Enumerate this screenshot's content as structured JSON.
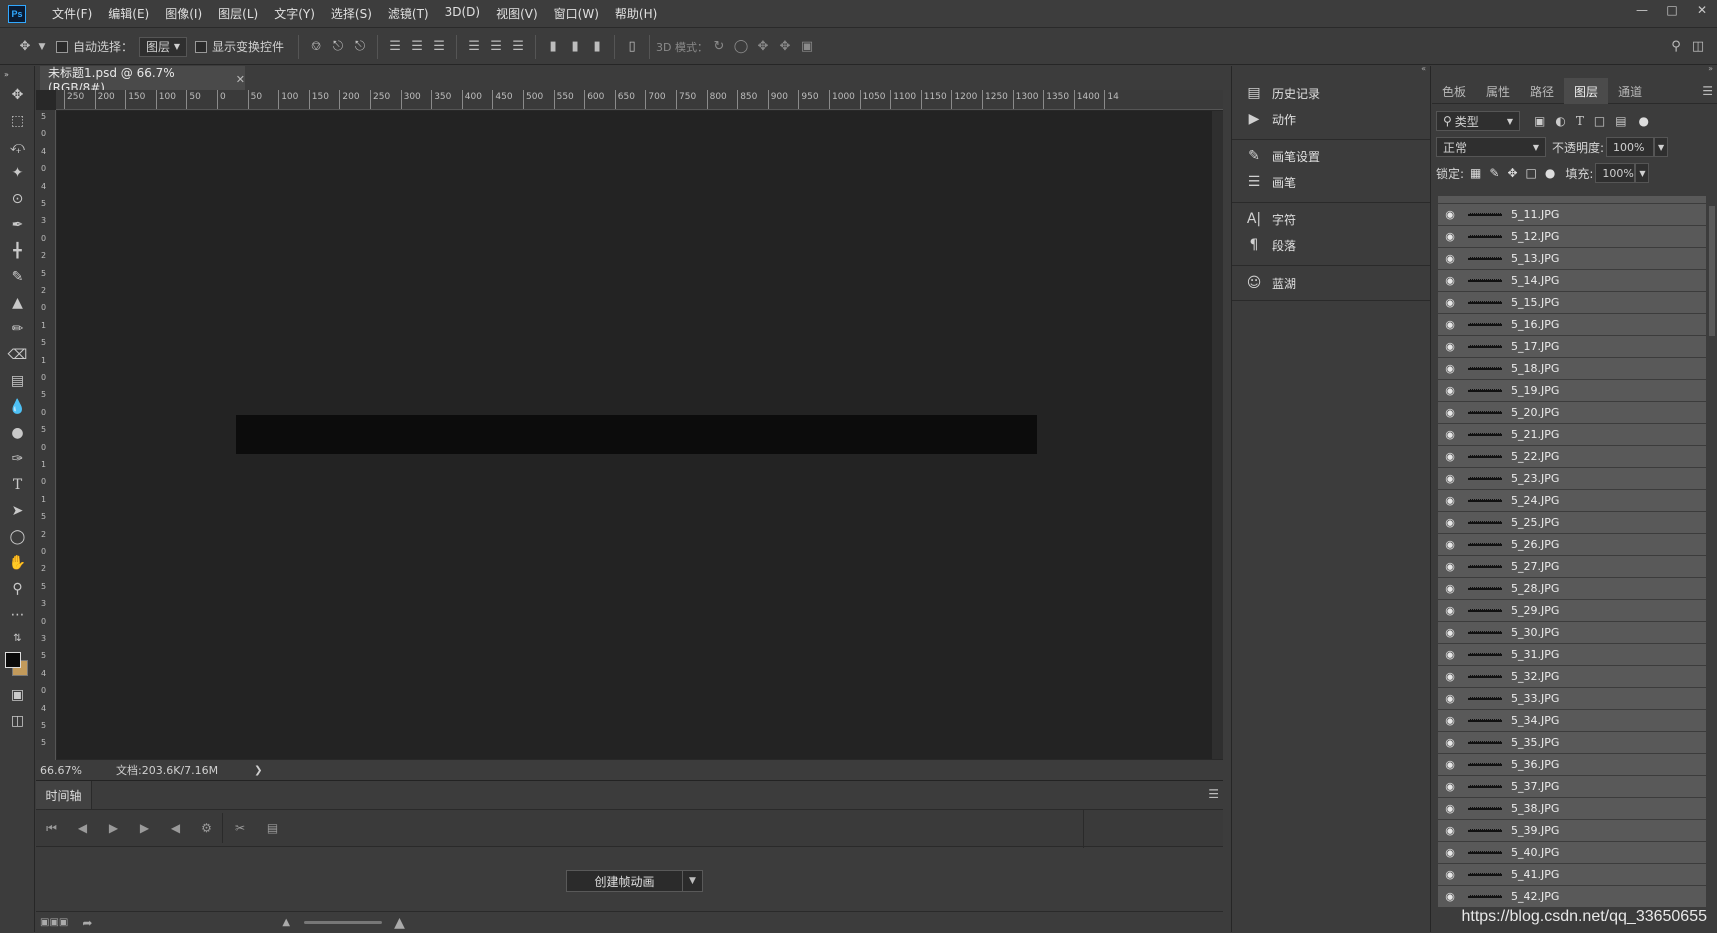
{
  "app": {
    "logo": "Ps",
    "menu": [
      "文件(F)",
      "编辑(E)",
      "图像(I)",
      "图层(L)",
      "文字(Y)",
      "选择(S)",
      "滤镜(T)",
      "3D(D)",
      "视图(V)",
      "窗口(W)",
      "帮助(H)"
    ]
  },
  "options_bar": {
    "auto_select_label": "自动选择：",
    "auto_select_value": "图层",
    "show_transform_label": "显示变换控件",
    "mode_3d_label": "3D 模式："
  },
  "document": {
    "tab_title": "未标题1.psd @ 66.7%(RGB/8#)",
    "zoom": "66.67%",
    "doc_size": "文档:203.6K/7.16M"
  },
  "ruler_h_labels": [
    "250",
    "200",
    "150",
    "100",
    "50",
    "0",
    "50",
    "100",
    "150",
    "200",
    "250",
    "300",
    "350",
    "400",
    "450",
    "500",
    "550",
    "600",
    "650",
    "700",
    "750",
    "800",
    "850",
    "900",
    "950",
    "1000",
    "1050",
    "1100",
    "1150",
    "1200",
    "1250",
    "1300",
    "1350",
    "1400",
    "14"
  ],
  "ruler_v_labels": [
    "5",
    "0",
    "4",
    "0",
    "4",
    "5",
    "3",
    "0",
    "2",
    "5",
    "2",
    "0",
    "1",
    "5",
    "1",
    "0",
    "5",
    "0",
    "5",
    "0",
    "1",
    "0",
    "1",
    "5",
    "2",
    "0",
    "2",
    "5",
    "3",
    "0",
    "3",
    "5",
    "4",
    "0",
    "4",
    "5",
    "5"
  ],
  "timeline": {
    "tab_label": "时间轴",
    "create_button": "创建帧动画"
  },
  "mid_panel": {
    "items": [
      {
        "icon": "history-icon",
        "label": "历史记录"
      },
      {
        "icon": "play-icon",
        "label": "动作"
      },
      {
        "icon": "brush-settings-icon",
        "label": "画笔设置"
      },
      {
        "icon": "brush-icon",
        "label": "画笔"
      },
      {
        "icon": "character-icon",
        "label": "字符"
      },
      {
        "icon": "paragraph-icon",
        "label": "段落"
      },
      {
        "icon": "alien-icon",
        "label": "蓝湖"
      }
    ]
  },
  "layers_panel": {
    "tabs": [
      "色板",
      "属性",
      "路径",
      "图层",
      "通道"
    ],
    "active_tab": "图层",
    "filter_label": "类型",
    "blend_mode": "正常",
    "opacity_label": "不透明度:",
    "opacity_value": "100%",
    "lock_label": "锁定:",
    "fill_label": "填充:",
    "fill_value": "100%",
    "layers": [
      "5_11.JPG",
      "5_12.JPG",
      "5_13.JPG",
      "5_14.JPG",
      "5_15.JPG",
      "5_16.JPG",
      "5_17.JPG",
      "5_18.JPG",
      "5_19.JPG",
      "5_20.JPG",
      "5_21.JPG",
      "5_22.JPG",
      "5_23.JPG",
      "5_24.JPG",
      "5_25.JPG",
      "5_26.JPG",
      "5_27.JPG",
      "5_28.JPG",
      "5_29.JPG",
      "5_30.JPG",
      "5_31.JPG",
      "5_32.JPG",
      "5_33.JPG",
      "5_34.JPG",
      "5_35.JPG",
      "5_36.JPG",
      "5_37.JPG",
      "5_38.JPG",
      "5_39.JPG",
      "5_40.JPG",
      "5_41.JPG",
      "5_42.JPG"
    ]
  },
  "watermark": "https://blog.csdn.net/qq_33650655"
}
